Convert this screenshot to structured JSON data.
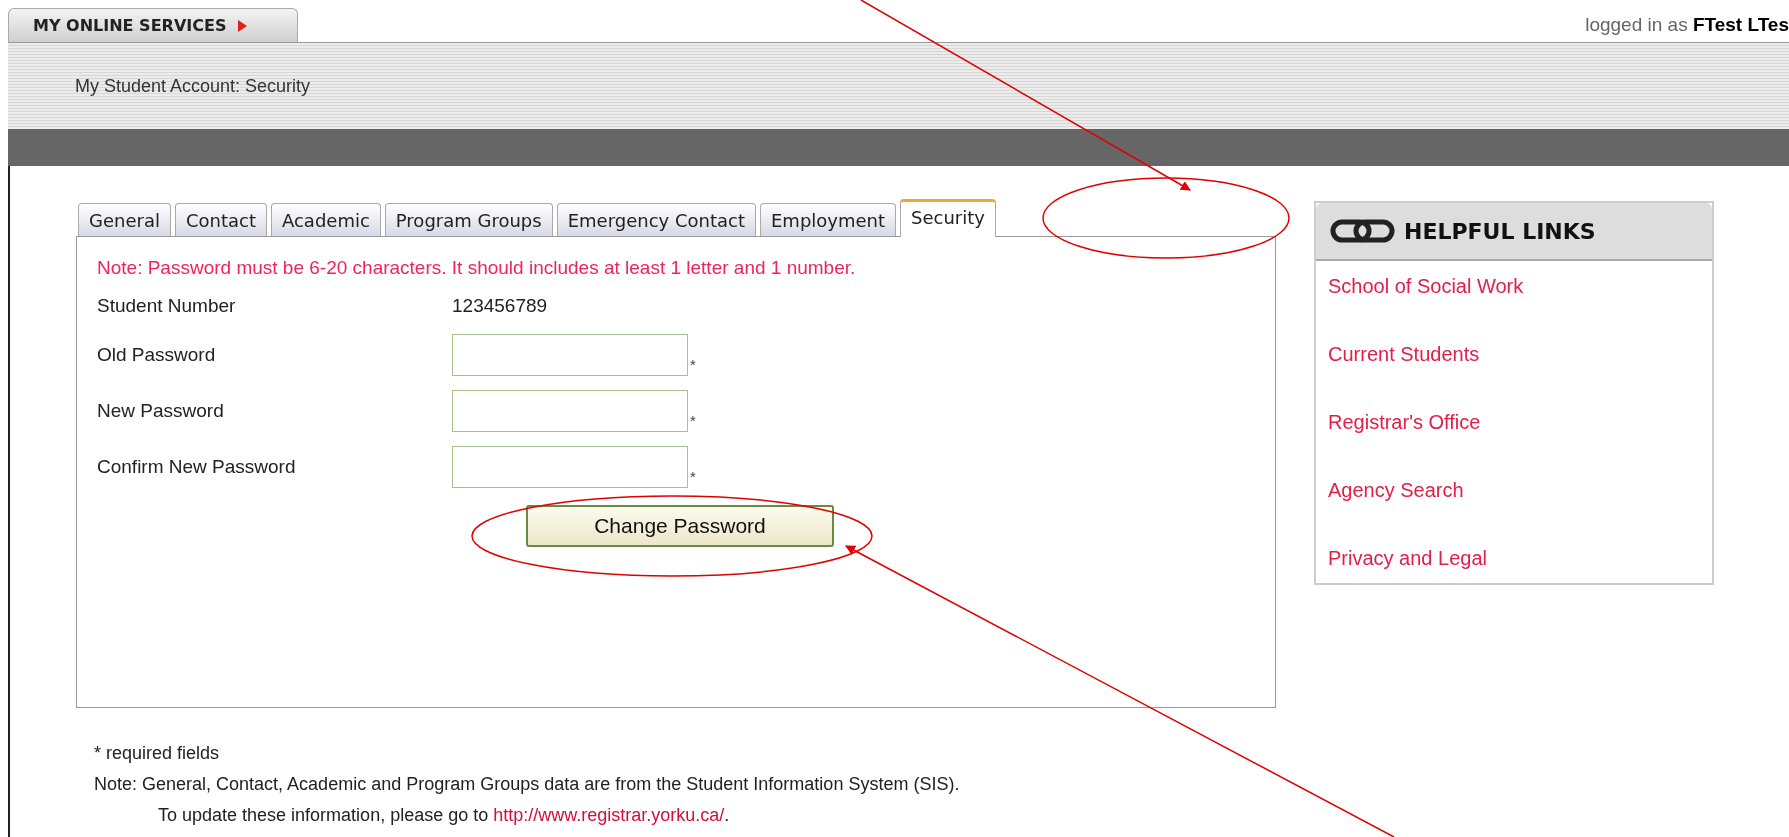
{
  "header": {
    "tab_label": "MY ONLINE SERVICES",
    "login_prefix": "logged in as",
    "user_name": "FTest LTes"
  },
  "breadcrumb": "My Student Account: Security",
  "tabs": [
    {
      "label": "General",
      "selected": false
    },
    {
      "label": "Contact",
      "selected": false
    },
    {
      "label": "Academic",
      "selected": false
    },
    {
      "label": "Program Groups",
      "selected": false
    },
    {
      "label": "Emergency Contact",
      "selected": false
    },
    {
      "label": "Employment",
      "selected": false
    },
    {
      "label": "Security",
      "selected": true
    }
  ],
  "note": "Note: Password must be 6-20 characters. It should includes at least 1 letter and 1 number.",
  "student_number": {
    "label": "Student Number",
    "value": "123456789"
  },
  "fields": [
    {
      "label": "Old Password",
      "required_mark": "*"
    },
    {
      "label": "New Password",
      "required_mark": "*"
    },
    {
      "label": "Confirm New Password",
      "required_mark": "*"
    }
  ],
  "submit_button": "Change Password",
  "helpful_links": {
    "title": "HELPFUL LINKS",
    "items": [
      "School of Social Work",
      "Current Students",
      "Registrar's Office",
      "Agency Search",
      "Privacy and Legal"
    ]
  },
  "footer": {
    "required_note": "* required fields",
    "note": "Note: General, Contact, Academic and Program Groups data are from the Student Information System (SIS).",
    "update_text": "To update these information, please go to ",
    "link": "http://www.registrar.yorku.ca/",
    "trailing": "."
  }
}
